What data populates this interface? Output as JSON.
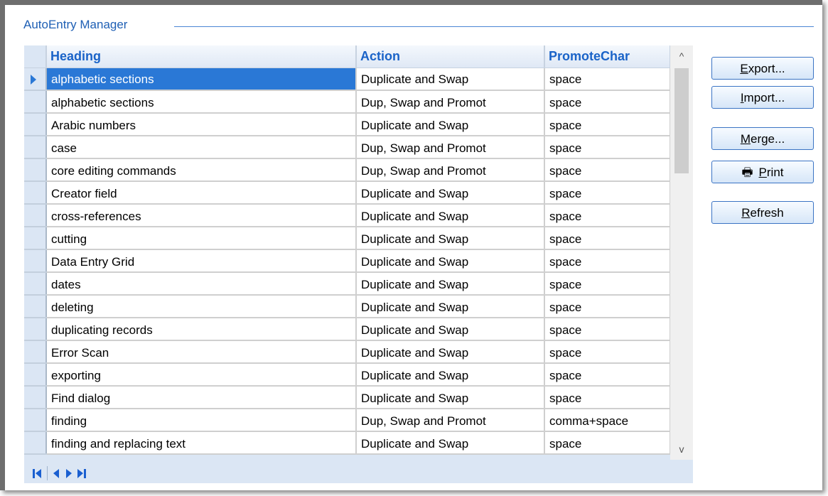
{
  "group": {
    "title": "AutoEntry Manager"
  },
  "grid": {
    "columns": [
      "Heading",
      "Action",
      "PromoteChar"
    ],
    "selected_row": 0,
    "rows": [
      [
        "alphabetic sections",
        "Duplicate and Swap",
        "space"
      ],
      [
        "alphabetic sections",
        "Dup, Swap and Promot",
        "space"
      ],
      [
        "Arabic numbers",
        "Duplicate and Swap",
        "space"
      ],
      [
        "case",
        "Dup, Swap and Promot",
        "space"
      ],
      [
        "core editing commands",
        "Dup, Swap and Promot",
        "space"
      ],
      [
        "Creator field",
        "Duplicate and Swap",
        "space"
      ],
      [
        "cross-references",
        "Duplicate and Swap",
        "space"
      ],
      [
        "cutting",
        "Duplicate and Swap",
        "space"
      ],
      [
        "Data Entry Grid",
        "Duplicate and Swap",
        "space"
      ],
      [
        "dates",
        "Duplicate and Swap",
        "space"
      ],
      [
        "deleting",
        "Duplicate and Swap",
        "space"
      ],
      [
        "duplicating records",
        "Duplicate and Swap",
        "space"
      ],
      [
        "Error Scan",
        "Duplicate and Swap",
        "space"
      ],
      [
        "exporting",
        "Duplicate and Swap",
        "space"
      ],
      [
        "Find dialog",
        "Duplicate and Swap",
        "space"
      ],
      [
        "finding",
        "Dup, Swap and Promot",
        "comma+space"
      ],
      [
        "finding and replacing text",
        "Duplicate and Swap",
        "space"
      ]
    ]
  },
  "scrollbar": {
    "up_icon": "chevron-up-icon",
    "down_icon": "chevron-down-icon",
    "up": "^",
    "down": "v"
  },
  "navigator": {
    "icons": [
      "first-record-icon",
      "prev-record-icon",
      "next-record-icon",
      "last-record-icon"
    ]
  },
  "buttons": {
    "export": {
      "label_mn": "E",
      "label_rest": "xport..."
    },
    "import": {
      "label_mn": "I",
      "label_rest": "mport..."
    },
    "merge": {
      "label_mn": "M",
      "label_rest": "erge..."
    },
    "print": {
      "label_mn": "P",
      "label_rest": "rint",
      "icon": "printer-icon"
    },
    "refresh": {
      "label_mn": "R",
      "label_rest": "efresh"
    }
  },
  "colors": {
    "accent": "#2a78d6",
    "header_text": "#1a63c8",
    "group_title": "#1e5fb4",
    "grid_bg": "#dbe6f4"
  }
}
